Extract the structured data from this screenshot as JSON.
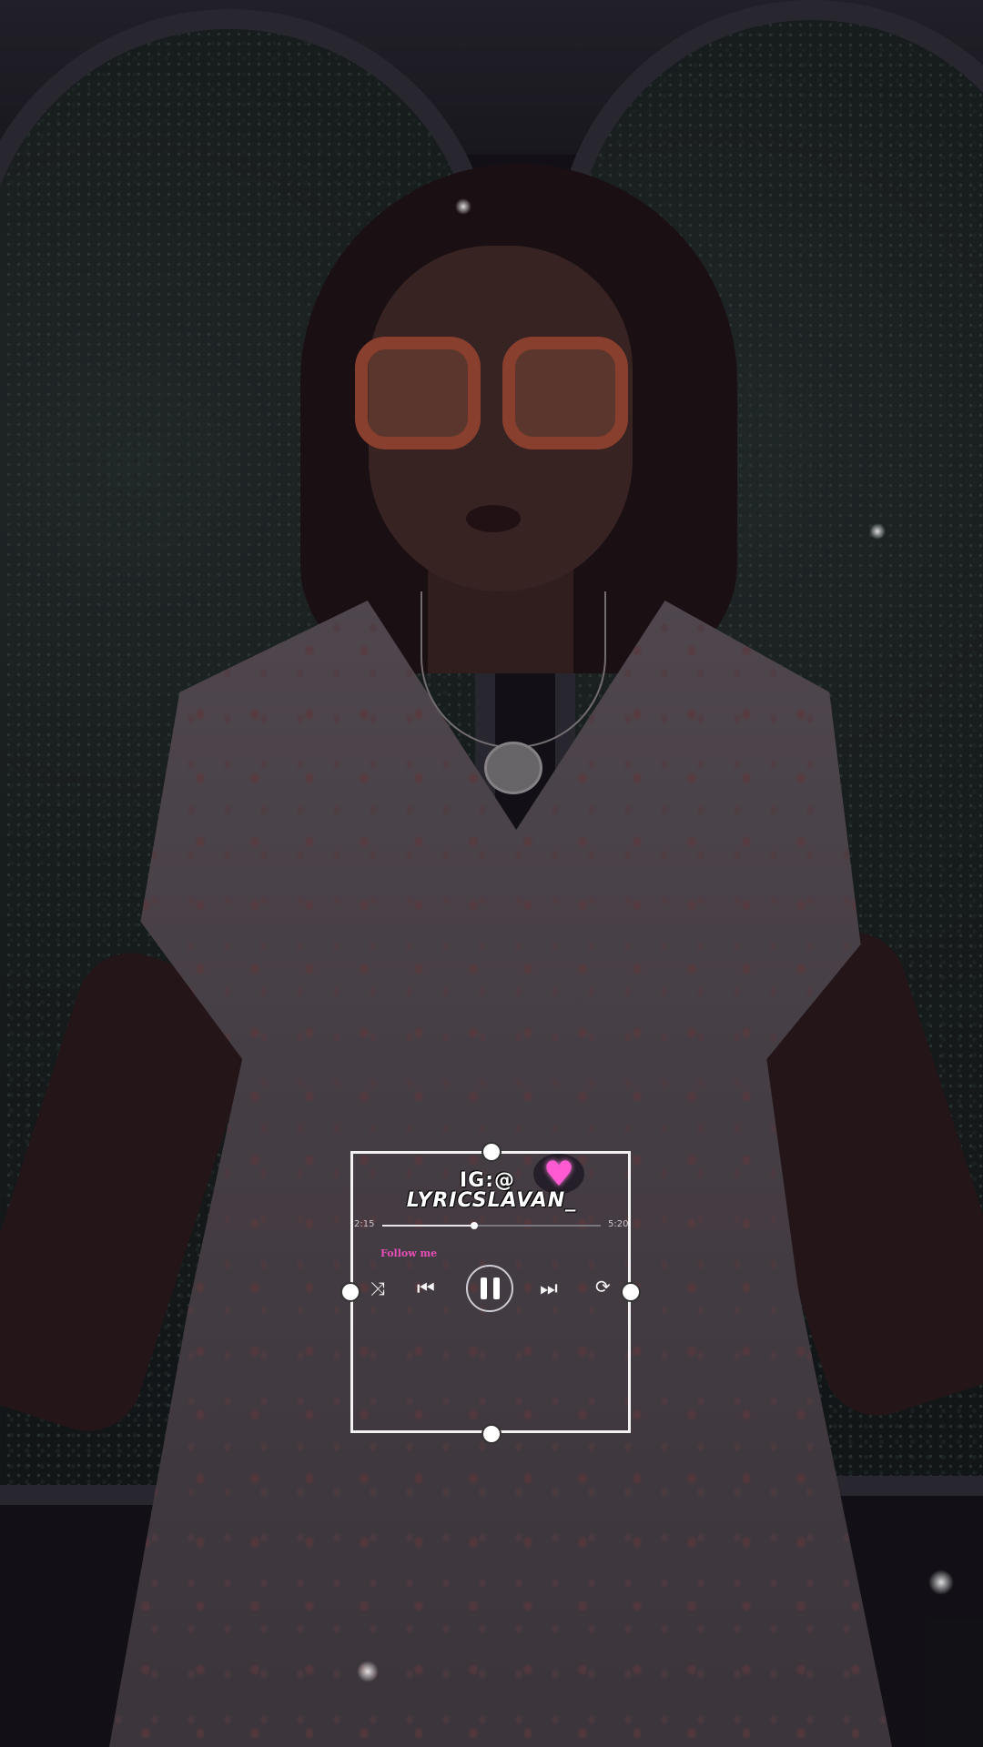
{
  "player": {
    "ig_handle": "IG:@",
    "username": "LYRICSLAVAN_",
    "current_time": "2:15",
    "total_time": "5:20",
    "progress": 0.42,
    "follow_text": "Follow me",
    "accent_color": "#e64fb8",
    "state": "playing",
    "icons": {
      "heart": "heart-icon",
      "shuffle": "shuffle-icon",
      "previous": "skip-previous-icon",
      "play_pause": "pause-icon",
      "next": "skip-next-icon",
      "repeat": "repeat-icon"
    }
  }
}
